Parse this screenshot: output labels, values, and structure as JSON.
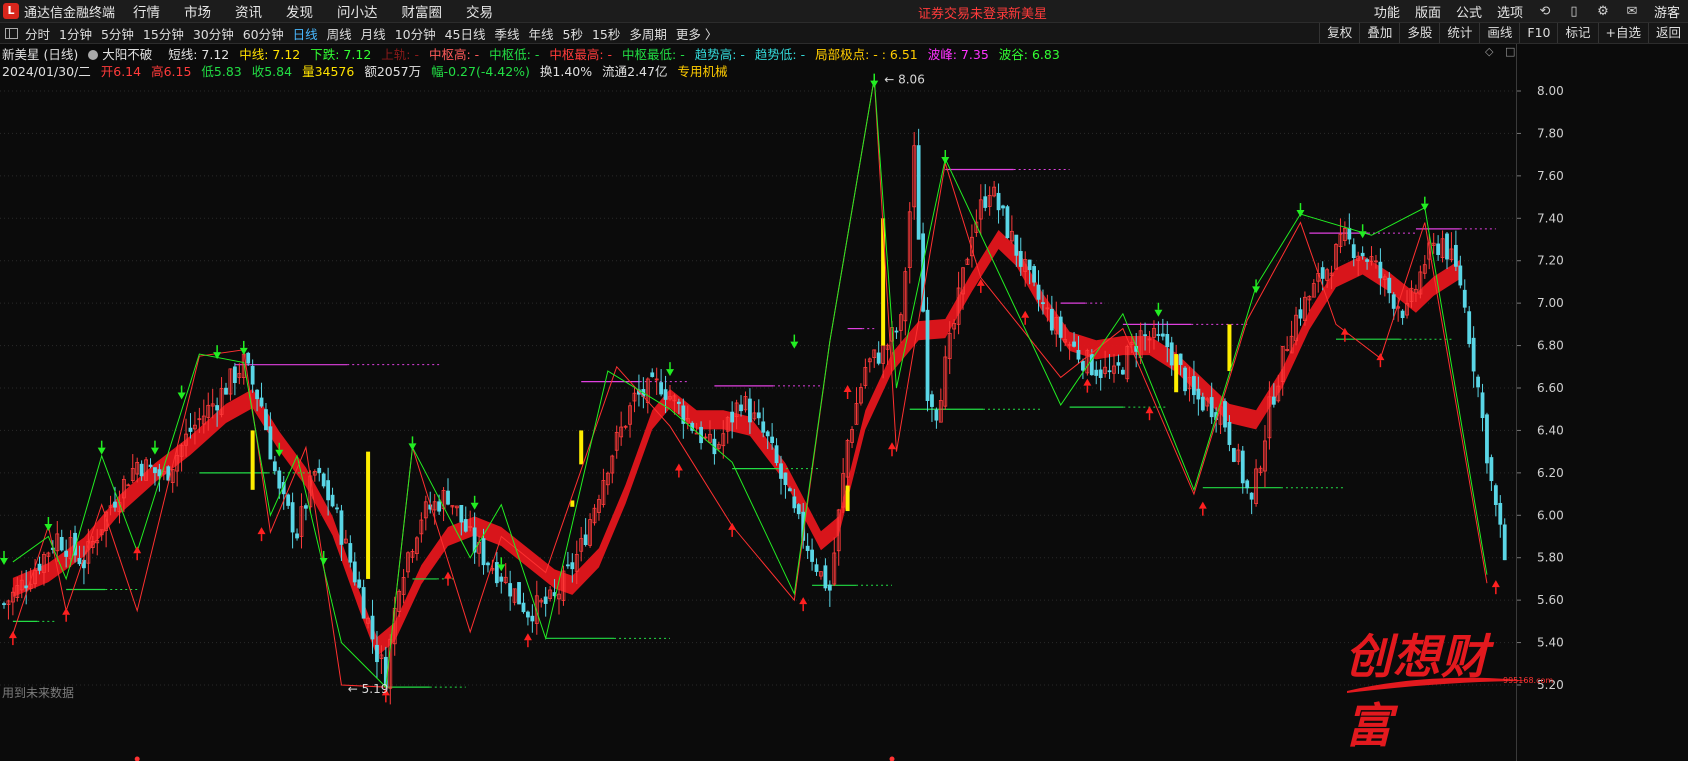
{
  "topbar": {
    "app_title": "通达信金融终端",
    "menu": [
      "行情",
      "市场",
      "资讯",
      "发现",
      "问小达",
      "财富圈",
      "交易"
    ],
    "login_status": "证券交易未登录",
    "login_stock": "新美星",
    "right_items": [
      "功能",
      "版面",
      "公式",
      "选项"
    ],
    "guest": "游客"
  },
  "periodbar": {
    "periods": [
      "分时",
      "1分钟",
      "5分钟",
      "15分钟",
      "30分钟",
      "60分钟",
      "日线",
      "周线",
      "月线",
      "10分钟",
      "45日线",
      "季线",
      "年线",
      "5秒",
      "15秒",
      "多周期",
      "更多 〉"
    ],
    "active_period": "日线",
    "tools": [
      "复权",
      "叠加",
      "多股",
      "统计",
      "画线",
      "F10",
      "标记",
      "+自选",
      "返回"
    ]
  },
  "indicator": {
    "stock_label": "新美星 (日线)",
    "formula": "大阳不破",
    "items": [
      {
        "text": "短线: 7.12",
        "color": "white"
      },
      {
        "text": "中线: 7.12",
        "color": "yellow"
      },
      {
        "text": "下跌: 7.12",
        "color": "lime"
      },
      {
        "text": "上轨: -",
        "color": "darkred"
      },
      {
        "text": "中枢高: -",
        "color": "red"
      },
      {
        "text": "中枢低: -",
        "color": "green"
      },
      {
        "text": "中枢最高: -",
        "color": "red"
      },
      {
        "text": "中枢最低: -",
        "color": "green"
      },
      {
        "text": "趋势高: -",
        "color": "cyan"
      },
      {
        "text": "趋势低: -",
        "color": "cyan"
      },
      {
        "text": "局部极点: - : 6.51",
        "color": "yellow"
      },
      {
        "text": "波峰: 7.35",
        "color": "magenta"
      },
      {
        "text": "波谷: 6.83",
        "color": "lime"
      }
    ]
  },
  "quote": {
    "date": "2024/01/30/二",
    "open": "开6.14",
    "high": "高6.15",
    "low": "低5.83",
    "close": "收5.84",
    "volume": "量34576",
    "amount": "额2057万",
    "change": "幅-0.27(-4.42%)",
    "turnover": "换1.40%",
    "float": "流通2.47亿",
    "sector": "专用机械"
  },
  "footer_note": "用到未来数据",
  "watermark": {
    "text": "创想财富",
    "sub": "995168.com"
  },
  "annotations": {
    "high": "8.06",
    "low": "5.19"
  },
  "colors": {
    "up": "#ff3b3b",
    "down": "#5ad6e6",
    "ribbon": "#e4161c",
    "zigzag_red": "#ff3030",
    "zigzag_green": "#22ee22",
    "level_magenta": "#e040e0",
    "level_green": "#22dd44",
    "flag_yellow": "#ffee00"
  },
  "chart_data": {
    "type": "candlestick",
    "ylim": [
      5.1,
      8.2
    ],
    "y_ticks": [
      "8.00",
      "7.80",
      "7.60",
      "7.40",
      "7.20",
      "7.00",
      "6.80",
      "6.60",
      "6.40",
      "6.20",
      "6.00",
      "5.80",
      "5.60",
      "5.40",
      "5.20"
    ],
    "close_path": [
      [
        0,
        5.58
      ],
      [
        6,
        5.72
      ],
      [
        12,
        5.9
      ],
      [
        18,
        5.78
      ],
      [
        24,
        6.05
      ],
      [
        30,
        6.25
      ],
      [
        36,
        6.18
      ],
      [
        42,
        6.4
      ],
      [
        48,
        6.55
      ],
      [
        54,
        6.72
      ],
      [
        58,
        6.52
      ],
      [
        62,
        6.1
      ],
      [
        66,
        5.92
      ],
      [
        70,
        6.2
      ],
      [
        74,
        6.05
      ],
      [
        80,
        5.65
      ],
      [
        84,
        5.35
      ],
      [
        86,
        5.25
      ],
      [
        89,
        5.7
      ],
      [
        94,
        6.0
      ],
      [
        100,
        6.1
      ],
      [
        106,
        5.85
      ],
      [
        112,
        5.72
      ],
      [
        118,
        5.55
      ],
      [
        124,
        5.6
      ],
      [
        130,
        5.85
      ],
      [
        136,
        6.25
      ],
      [
        142,
        6.55
      ],
      [
        148,
        6.62
      ],
      [
        154,
        6.45
      ],
      [
        160,
        6.3
      ],
      [
        166,
        6.55
      ],
      [
        172,
        6.35
      ],
      [
        178,
        6.0
      ],
      [
        184,
        5.72
      ],
      [
        186,
        5.65
      ],
      [
        190,
        6.35
      ],
      [
        194,
        6.7
      ],
      [
        198,
        6.78
      ],
      [
        202,
        6.9
      ],
      [
        205,
        7.7
      ],
      [
        208,
        6.6
      ],
      [
        210,
        6.5
      ],
      [
        214,
        6.9
      ],
      [
        218,
        7.35
      ],
      [
        222,
        7.55
      ],
      [
        226,
        7.35
      ],
      [
        232,
        7.05
      ],
      [
        238,
        6.85
      ],
      [
        244,
        6.72
      ],
      [
        250,
        6.65
      ],
      [
        256,
        6.85
      ],
      [
        262,
        6.8
      ],
      [
        268,
        6.55
      ],
      [
        274,
        6.5
      ],
      [
        278,
        6.25
      ],
      [
        281,
        6.05
      ],
      [
        285,
        6.5
      ],
      [
        290,
        6.9
      ],
      [
        296,
        7.1
      ],
      [
        302,
        7.3
      ],
      [
        308,
        7.2
      ],
      [
        312,
        7.05
      ],
      [
        316,
        6.95
      ],
      [
        320,
        7.2
      ],
      [
        324,
        7.3
      ],
      [
        328,
        7.1
      ],
      [
        332,
        6.6
      ],
      [
        335,
        6.15
      ],
      [
        338,
        5.8
      ]
    ],
    "ribbon_path": [
      [
        2,
        5.66
      ],
      [
        10,
        5.73
      ],
      [
        18,
        5.85
      ],
      [
        26,
        6.05
      ],
      [
        34,
        6.2
      ],
      [
        42,
        6.33
      ],
      [
        50,
        6.48
      ],
      [
        56,
        6.55
      ],
      [
        62,
        6.35
      ],
      [
        68,
        6.18
      ],
      [
        74,
        5.95
      ],
      [
        80,
        5.6
      ],
      [
        84,
        5.38
      ],
      [
        88,
        5.45
      ],
      [
        94,
        5.72
      ],
      [
        100,
        5.9
      ],
      [
        106,
        5.95
      ],
      [
        112,
        5.9
      ],
      [
        118,
        5.8
      ],
      [
        124,
        5.7
      ],
      [
        128,
        5.67
      ],
      [
        134,
        5.8
      ],
      [
        140,
        6.1
      ],
      [
        146,
        6.45
      ],
      [
        150,
        6.55
      ],
      [
        156,
        6.45
      ],
      [
        162,
        6.45
      ],
      [
        168,
        6.42
      ],
      [
        176,
        6.2
      ],
      [
        184,
        5.88
      ],
      [
        188,
        5.95
      ],
      [
        194,
        6.45
      ],
      [
        200,
        6.72
      ],
      [
        206,
        6.87
      ],
      [
        212,
        6.88
      ],
      [
        218,
        7.1
      ],
      [
        224,
        7.3
      ],
      [
        228,
        7.22
      ],
      [
        234,
        7.0
      ],
      [
        240,
        6.82
      ],
      [
        246,
        6.78
      ],
      [
        252,
        6.8
      ],
      [
        258,
        6.8
      ],
      [
        264,
        6.72
      ],
      [
        270,
        6.6
      ],
      [
        276,
        6.48
      ],
      [
        282,
        6.45
      ],
      [
        288,
        6.65
      ],
      [
        294,
        6.92
      ],
      [
        300,
        7.12
      ],
      [
        306,
        7.18
      ],
      [
        312,
        7.1
      ],
      [
        318,
        7.0
      ],
      [
        322,
        7.08
      ],
      [
        328,
        7.16
      ]
    ],
    "zigzag_red": [
      [
        2,
        5.44
      ],
      [
        10,
        5.95
      ],
      [
        14,
        5.55
      ],
      [
        22,
        6.05
      ],
      [
        30,
        5.55
      ],
      [
        44,
        6.75
      ],
      [
        54,
        6.78
      ],
      [
        60,
        5.92
      ],
      [
        68,
        6.32
      ],
      [
        76,
        5.2
      ],
      [
        86,
        5.19
      ],
      [
        92,
        6.32
      ],
      [
        105,
        5.45
      ],
      [
        112,
        5.9
      ],
      [
        122,
        5.73
      ],
      [
        138,
        6.7
      ],
      [
        150,
        6.42
      ],
      [
        164,
        5.95
      ],
      [
        178,
        5.6
      ],
      [
        186,
        6.82
      ],
      [
        196,
        8.06
      ],
      [
        201,
        6.3
      ],
      [
        212,
        7.66
      ],
      [
        220,
        7.12
      ],
      [
        238,
        6.65
      ],
      [
        252,
        6.88
      ],
      [
        268,
        6.1
      ],
      [
        280,
        6.92
      ],
      [
        292,
        7.38
      ],
      [
        300,
        6.9
      ],
      [
        310,
        6.74
      ],
      [
        320,
        7.38
      ],
      [
        334,
        5.68
      ]
    ],
    "zigzag_green": [
      [
        2,
        5.78
      ],
      [
        10,
        5.9
      ],
      [
        14,
        5.7
      ],
      [
        22,
        6.28
      ],
      [
        30,
        5.83
      ],
      [
        44,
        6.76
      ],
      [
        54,
        6.72
      ],
      [
        60,
        6.0
      ],
      [
        66,
        6.28
      ],
      [
        76,
        5.4
      ],
      [
        86,
        5.19
      ],
      [
        92,
        6.32
      ],
      [
        105,
        5.8
      ],
      [
        112,
        6.05
      ],
      [
        122,
        5.42
      ],
      [
        136,
        6.68
      ],
      [
        150,
        6.5
      ],
      [
        164,
        6.25
      ],
      [
        178,
        5.63
      ],
      [
        186,
        6.82
      ],
      [
        196,
        8.06
      ],
      [
        201,
        6.6
      ],
      [
        212,
        7.68
      ],
      [
        238,
        6.52
      ],
      [
        252,
        6.95
      ],
      [
        268,
        6.12
      ],
      [
        282,
        7.08
      ],
      [
        292,
        7.42
      ],
      [
        308,
        7.32
      ],
      [
        320,
        7.45
      ],
      [
        334,
        5.72
      ]
    ],
    "resistance_levels": [
      [
        52,
        6.71,
        98
      ],
      [
        130,
        6.63,
        154
      ],
      [
        160,
        6.61,
        184
      ],
      [
        190,
        6.88,
        196
      ],
      [
        212,
        7.63,
        240
      ],
      [
        238,
        7.0,
        248
      ],
      [
        252,
        6.9,
        280
      ],
      [
        294,
        7.33,
        318
      ],
      [
        318,
        7.35,
        336
      ]
    ],
    "support_levels": [
      [
        2,
        5.5,
        12
      ],
      [
        14,
        5.65,
        30
      ],
      [
        44,
        6.2,
        72
      ],
      [
        86,
        5.19,
        104
      ],
      [
        92,
        5.7,
        102
      ],
      [
        122,
        5.42,
        150
      ],
      [
        164,
        6.22,
        184
      ],
      [
        182,
        5.67,
        200
      ],
      [
        204,
        6.5,
        234
      ],
      [
        240,
        6.51,
        262
      ],
      [
        270,
        6.13,
        302
      ],
      [
        300,
        6.83,
        326
      ]
    ],
    "high_markers": [
      [
        0,
        5.78
      ],
      [
        10,
        5.94
      ],
      [
        22,
        6.3
      ],
      [
        34,
        6.3
      ],
      [
        40,
        6.56
      ],
      [
        48,
        6.75
      ],
      [
        54,
        6.77
      ],
      [
        62,
        6.29
      ],
      [
        72,
        5.78
      ],
      [
        92,
        6.32
      ],
      [
        106,
        6.04
      ],
      [
        112,
        5.75
      ],
      [
        150,
        6.67
      ],
      [
        178,
        6.8
      ],
      [
        196,
        8.03
      ],
      [
        212,
        7.67
      ],
      [
        260,
        6.95
      ],
      [
        282,
        7.06
      ],
      [
        292,
        7.42
      ],
      [
        306,
        7.32
      ],
      [
        320,
        7.45
      ]
    ],
    "low_markers": [
      [
        2,
        5.44
      ],
      [
        14,
        5.55
      ],
      [
        30,
        5.84
      ],
      [
        58,
        5.93
      ],
      [
        86,
        5.17
      ],
      [
        100,
        5.72
      ],
      [
        118,
        5.43
      ],
      [
        152,
        6.23
      ],
      [
        164,
        5.95
      ],
      [
        180,
        5.6
      ],
      [
        190,
        6.6
      ],
      [
        200,
        6.33
      ],
      [
        220,
        7.1
      ],
      [
        230,
        6.95
      ],
      [
        244,
        6.63
      ],
      [
        258,
        6.5
      ],
      [
        270,
        6.05
      ],
      [
        302,
        6.87
      ],
      [
        310,
        6.75
      ],
      [
        336,
        5.68
      ]
    ],
    "yellow_flags": [
      [
        56,
        6.12,
        6.4
      ],
      [
        82,
        5.7,
        6.3
      ],
      [
        130,
        6.24,
        6.4
      ],
      [
        128,
        6.04,
        6.07
      ],
      [
        190,
        6.02,
        6.14
      ],
      [
        198,
        6.8,
        7.4
      ],
      [
        264,
        6.58,
        6.76
      ],
      [
        276,
        6.68,
        6.9
      ]
    ],
    "bottom_markers": [
      [
        30
      ],
      [
        200
      ]
    ]
  }
}
